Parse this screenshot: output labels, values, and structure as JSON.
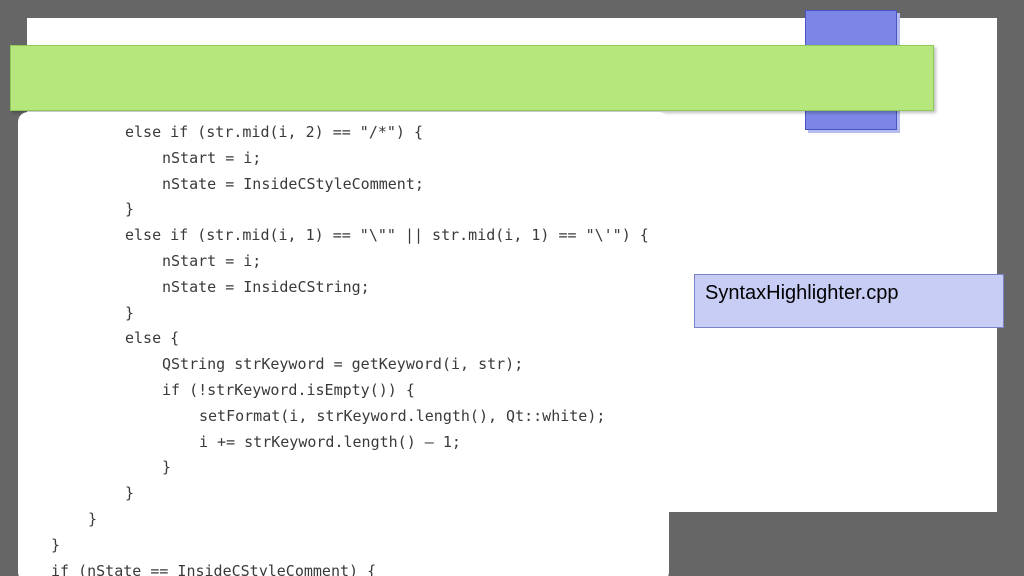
{
  "slide": {
    "file_label": "SyntaxHighlighter.cpp"
  },
  "code": {
    "lines": [
      {
        "indent": 2,
        "text": "else if (str.mid(i, 2) == \"/*\") {"
      },
      {
        "indent": 3,
        "text": "nStart = i;"
      },
      {
        "indent": 3,
        "text": "nState = InsideCStyleComment;"
      },
      {
        "indent": 2,
        "text": "}"
      },
      {
        "indent": 2,
        "text": "else if (str.mid(i, 1) == \"\\\"\" || str.mid(i, 1) == \"\\'\") {"
      },
      {
        "indent": 3,
        "text": "nStart = i;"
      },
      {
        "indent": 3,
        "text": "nState = InsideCString;"
      },
      {
        "indent": 2,
        "text": "}"
      },
      {
        "indent": 2,
        "text": "else {"
      },
      {
        "indent": 3,
        "text": "QString strKeyword = getKeyword(i, str);"
      },
      {
        "indent": 3,
        "text": "if (!strKeyword.isEmpty()) {"
      },
      {
        "indent": 4,
        "text": "setFormat(i, strKeyword.length(), Qt::white);"
      },
      {
        "indent": 4,
        "text": "i += strKeyword.length() — 1;"
      },
      {
        "indent": 3,
        "text": "}"
      },
      {
        "indent": 2,
        "text": "}"
      },
      {
        "indent": 1,
        "text": "}"
      },
      {
        "indent": 0,
        "text": "}"
      },
      {
        "indent": 0,
        "text": "if (nState == InsideCStyleComment) {"
      }
    ]
  },
  "colors": {
    "background": "#666666",
    "title_bar": "#b5e77d",
    "accent_square": "#7b86e6",
    "label_box": "#c7cdf5"
  }
}
